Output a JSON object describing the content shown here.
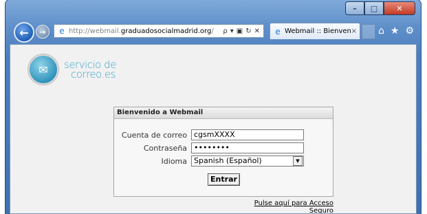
{
  "browser": {
    "address": {
      "url_prefix": "http://webmail.",
      "url_domain": "graduadosocialmadrid.org",
      "url_suffix": "/",
      "tools": {
        "search": "ρ",
        "dropdown": "▾",
        "compat": "▣",
        "refresh": "↻",
        "stop": "✕"
      }
    },
    "tab": {
      "title": "Webmail :: Bienvenido...",
      "close": "×"
    },
    "icons": [
      "home-icon",
      "star-icon",
      "gear-icon"
    ],
    "window_controls": {
      "minimize": "–",
      "maximize": "□",
      "close": "✕"
    }
  },
  "logo": {
    "line1": "servicio de",
    "line2": "correo.es"
  },
  "login": {
    "title": "Bienvenido a Webmail",
    "fields": {
      "user": {
        "label": "Cuenta de correo",
        "value": "cgsmXXXX"
      },
      "password": {
        "label": "Contraseña",
        "value": "••••••••"
      },
      "language": {
        "label": "Idioma",
        "value": "Spanish (Español)"
      }
    },
    "submit": "Entrar"
  },
  "secure_link": "Pulse aquí para Acceso Seguro"
}
